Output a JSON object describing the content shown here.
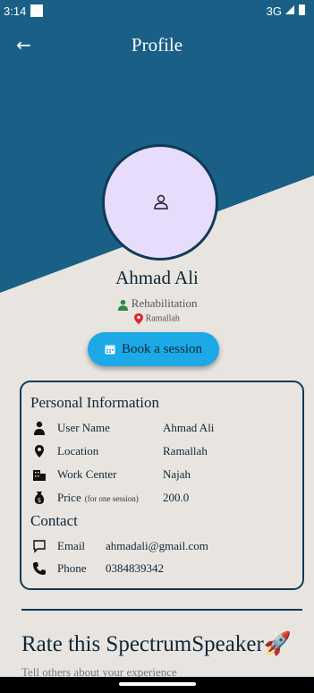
{
  "colors": {
    "header": "#1a5f86",
    "background": "#e8e5e0",
    "accent": "#1ca9e6",
    "avatar_bg": "#e7dcfb",
    "border": "#103a55"
  },
  "status_bar": {
    "time": "3:14",
    "network": "3G"
  },
  "header": {
    "title": "Profile",
    "back_icon": "arrow-left-icon"
  },
  "profile": {
    "name": "Ahmad Ali",
    "specialty": "Rehabilitation",
    "city": "Ramallah",
    "avatar_icon": "user-outline-icon"
  },
  "book_button": {
    "label": "Book a session",
    "icon": "calendar-icon"
  },
  "personal_info": {
    "title": "Personal Information",
    "rows": [
      {
        "label": "User Name",
        "value": "Ahmad Ali",
        "icon": "user-icon"
      },
      {
        "label": "Location",
        "value": "Ramallah",
        "icon": "location-pin-icon"
      },
      {
        "label": "Work Center",
        "value": "Najah",
        "icon": "building-icon"
      },
      {
        "label": "Price",
        "note": "(for one session)",
        "value": "200.0",
        "icon": "money-bag-icon"
      }
    ]
  },
  "contact": {
    "title": "Contact",
    "rows": [
      {
        "label": "Email",
        "value": "ahmadali@gmail.com",
        "icon": "chat-icon"
      },
      {
        "label": "Phone",
        "value": "0384839342",
        "icon": "phone-icon"
      }
    ]
  },
  "rate": {
    "title": "Rate this SpectrumSpeaker",
    "emoji": "🚀",
    "subtitle": "Tell others about your experience"
  }
}
